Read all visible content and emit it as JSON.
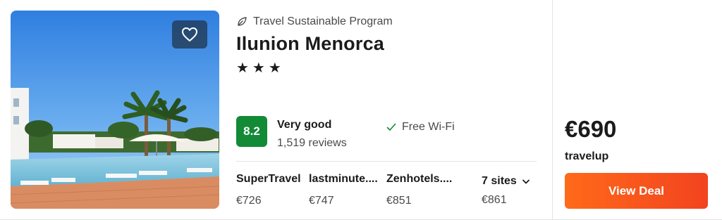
{
  "image": {
    "alt": "Hotel pool area with palm trees and sun loungers"
  },
  "favorite": {
    "icon": "heart-outline-icon"
  },
  "sustainability": {
    "icon": "leaf-icon",
    "label": "Travel Sustainable Program"
  },
  "hotel": {
    "name": "Ilunion Menorca",
    "stars": "★★★",
    "star_count": 3
  },
  "rating": {
    "score": "8.2",
    "label": "Very good",
    "reviews": "1,519 reviews",
    "color": "#138a36"
  },
  "amenity": {
    "icon": "checkmark-icon",
    "label": "Free Wi-Fi"
  },
  "sites": [
    {
      "name": "SuperTravel",
      "price": "€726"
    },
    {
      "name": "lastminute....",
      "price": "€747"
    },
    {
      "name": "Zenhotels....",
      "price": "€851"
    }
  ],
  "more_sites": {
    "label": "7 sites",
    "icon": "chevron-down-icon",
    "price": "€861"
  },
  "deal": {
    "price": "€690",
    "provider": "travelup",
    "button_label": "View Deal",
    "button_color": "#f2431f"
  }
}
